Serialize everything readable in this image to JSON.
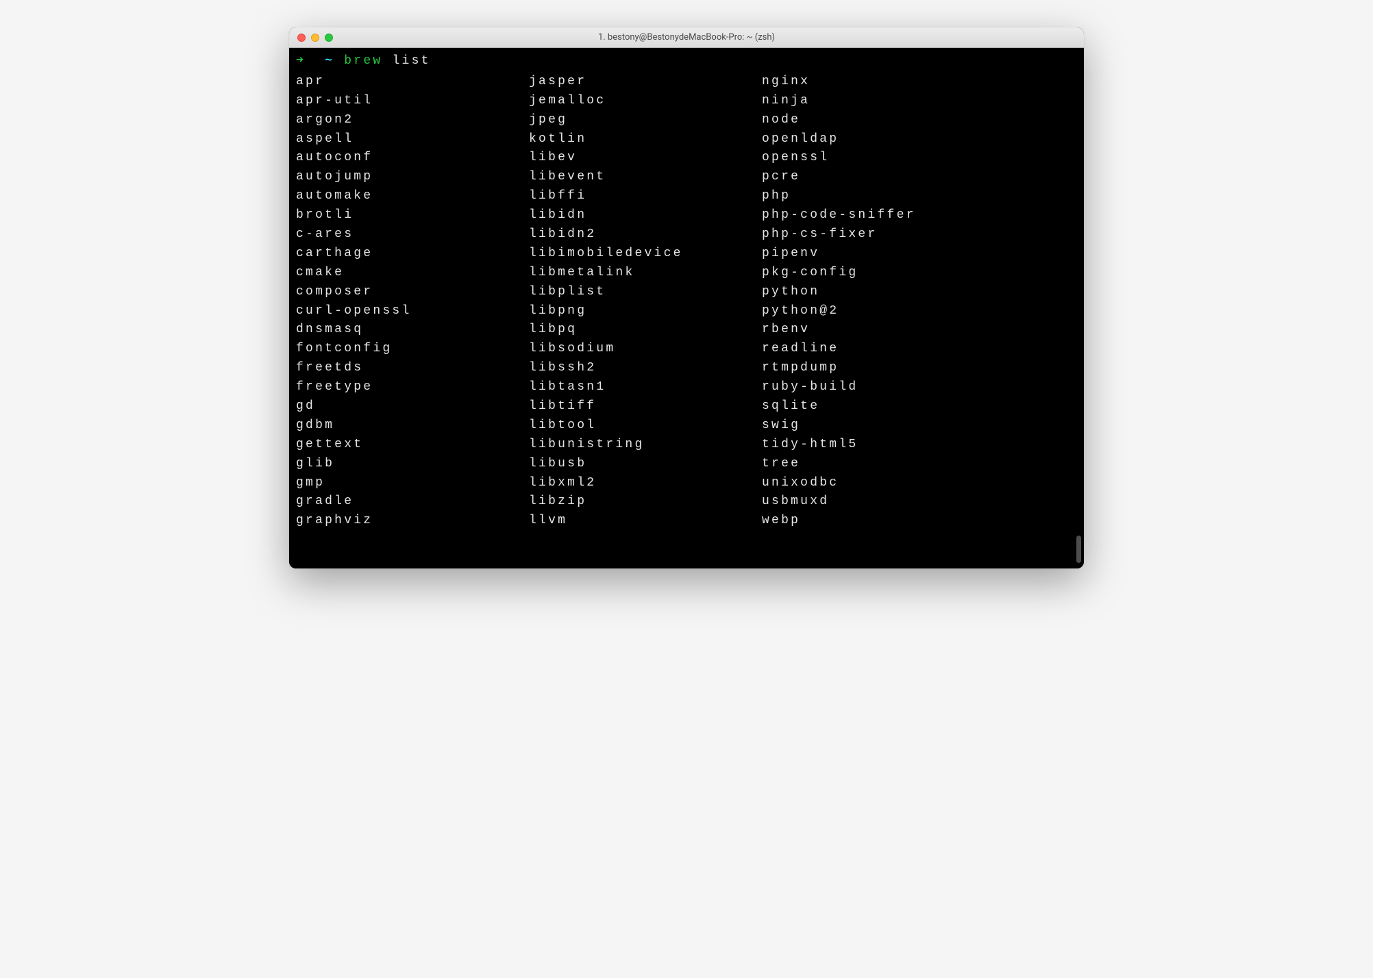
{
  "window": {
    "title": "1. bestony@BestonydeMacBook-Pro: ~ (zsh)"
  },
  "prompt": {
    "arrow": "➜",
    "cwd": "~",
    "command": "brew",
    "args": "list"
  },
  "packages": {
    "col1": [
      "apr",
      "apr-util",
      "argon2",
      "aspell",
      "autoconf",
      "autojump",
      "automake",
      "brotli",
      "c-ares",
      "carthage",
      "cmake",
      "composer",
      "curl-openssl",
      "dnsmasq",
      "fontconfig",
      "freetds",
      "freetype",
      "gd",
      "gdbm",
      "gettext",
      "glib",
      "gmp",
      "gradle",
      "graphviz"
    ],
    "col2": [
      "jasper",
      "jemalloc",
      "jpeg",
      "kotlin",
      "libev",
      "libevent",
      "libffi",
      "libidn",
      "libidn2",
      "libimobiledevice",
      "libmetalink",
      "libplist",
      "libpng",
      "libpq",
      "libsodium",
      "libssh2",
      "libtasn1",
      "libtiff",
      "libtool",
      "libunistring",
      "libusb",
      "libxml2",
      "libzip",
      "llvm"
    ],
    "col3": [
      "nginx",
      "ninja",
      "node",
      "openldap",
      "openssl",
      "pcre",
      "php",
      "php-code-sniffer",
      "php-cs-fixer",
      "pipenv",
      "pkg-config",
      "python",
      "python@2",
      "rbenv",
      "readline",
      "rtmpdump",
      "ruby-build",
      "sqlite",
      "swig",
      "tidy-html5",
      "tree",
      "unixodbc",
      "usbmuxd",
      "webp"
    ]
  }
}
